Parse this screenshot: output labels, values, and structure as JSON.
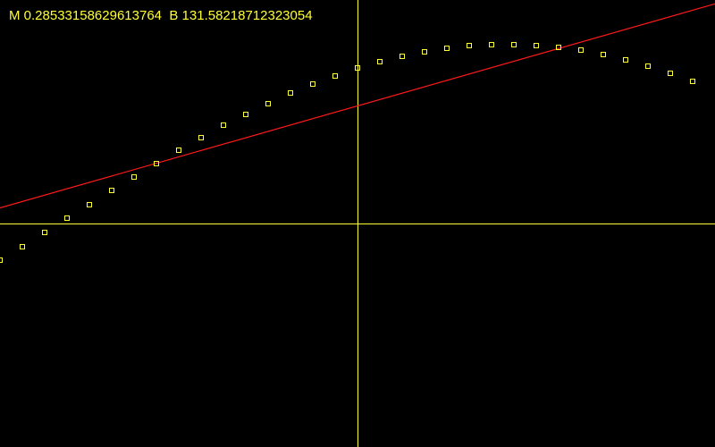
{
  "readout": {
    "m_label": "M",
    "m_value": "0.28533158629613764",
    "b_label": "B",
    "b_value": "131.58218712323054"
  },
  "colors": {
    "background": "#000000",
    "axes": "#ffff33",
    "points": "#ffff33",
    "fit_line": "#ff1a1a",
    "text": "#ffff33"
  },
  "chart_data": {
    "type": "scatter",
    "title": "",
    "xlabel": "",
    "ylabel": "",
    "xlim": [
      -400,
      400
    ],
    "ylim": [
      -250,
      250
    ],
    "grid": false,
    "axes_at_origin": true,
    "series": [
      {
        "x": [
          -400,
          -375,
          -350,
          -325,
          -300,
          -275,
          -250,
          -225,
          -200,
          -175,
          -150,
          -125,
          -100,
          -75,
          -50,
          -25,
          0,
          25,
          50,
          75,
          100,
          125,
          150,
          175,
          200,
          225,
          250,
          275,
          300,
          325,
          350,
          375
        ],
        "y": [
          -41,
          -26,
          -10,
          6,
          21,
          37,
          52,
          67,
          82,
          96,
          110,
          122,
          134,
          146,
          156,
          165,
          174,
          181,
          187,
          192,
          196,
          199,
          200,
          200,
          199,
          197,
          194,
          189,
          183,
          176,
          168,
          159
        ]
      }
    ],
    "fit_line": {
      "m": 0.28533158629613764,
      "b": 131.58218712323054
    }
  }
}
